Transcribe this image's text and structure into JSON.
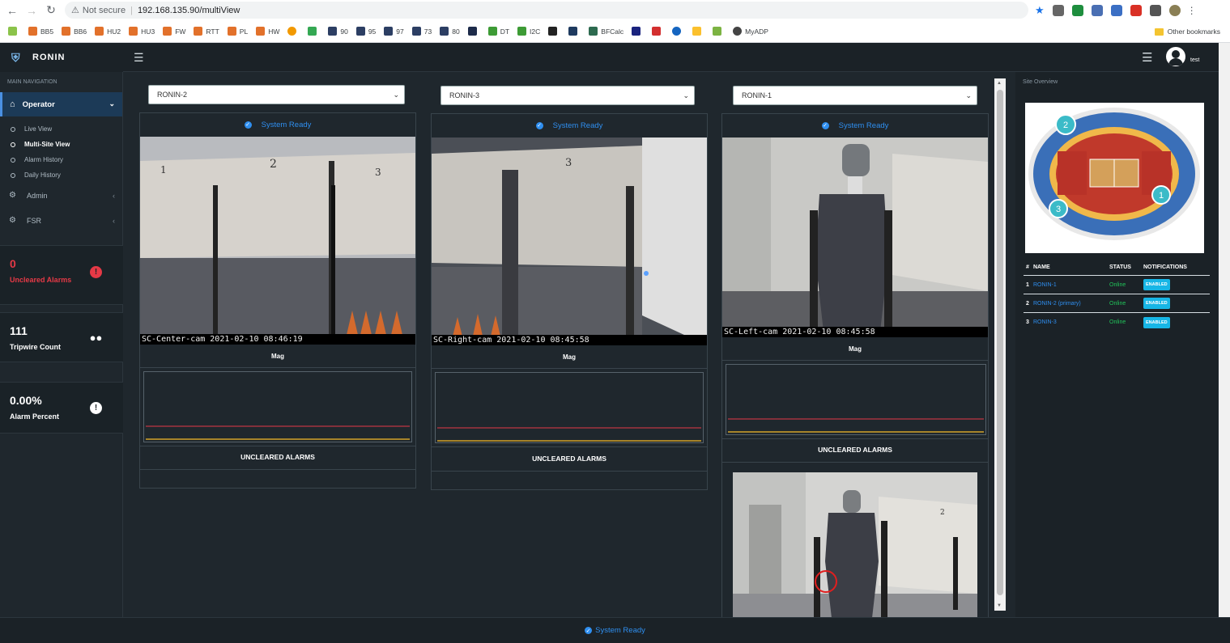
{
  "browser": {
    "security_label": "Not secure",
    "url": "192.168.135.90/multiView",
    "bookmarks": [
      "BB5",
      "BB6",
      "HU2",
      "HU3",
      "FW",
      "RTT",
      "PL",
      "HW",
      "",
      "",
      "90",
      "95",
      "97",
      "73",
      "80",
      "",
      "DT",
      "I2C",
      "",
      "",
      "BFCalc",
      "",
      "",
      "",
      "",
      "",
      "MyADP"
    ],
    "other_bookmarks": "Other bookmarks"
  },
  "app": {
    "brand": "RONIN",
    "user": "test"
  },
  "sidebar": {
    "heading": "MAIN NAVIGATION",
    "operator_label": "Operator",
    "sub_items": [
      "Live View",
      "Multi-Site View",
      "Alarm History",
      "Daily History"
    ],
    "admin_label": "Admin",
    "fsr_label": "FSR"
  },
  "stats": {
    "uncleared": {
      "value": "0",
      "label": "Uncleared Alarms"
    },
    "tripwire": {
      "value": "111",
      "label": "Tripwire Count"
    },
    "alarm_percent": {
      "value": "0.00%",
      "label": "Alarm Percent"
    }
  },
  "columns": [
    {
      "select": "RONIN-2",
      "status": "System Ready",
      "caption": "SC-Center-cam 2021-02-10 08:46:19",
      "mag_title": "Mag",
      "alarm_title": "UNCLEARED ALARMS"
    },
    {
      "select": "RONIN-3",
      "status": "System Ready",
      "caption": "SC-Right-cam 2021-02-10 08:45:58",
      "mag_title": "Mag",
      "alarm_title": "UNCLEARED ALARMS"
    },
    {
      "select": "RONIN-1",
      "status": "System Ready",
      "caption": "SC-Left-cam 2021-02-10 08:45:58",
      "mag_title": "Mag",
      "alarm_title": "UNCLEARED ALARMS"
    }
  ],
  "site_overview": {
    "title": "Site Overview",
    "markers": [
      "1",
      "2",
      "3"
    ],
    "columns": [
      "#",
      "NAME",
      "STATUS",
      "NOTIFICATIONS"
    ],
    "rows": [
      {
        "num": "1",
        "name": "RONIN-1",
        "status": "Online",
        "notif": "ENABLED"
      },
      {
        "num": "2",
        "name": "RONIN-2 (primary)",
        "status": "Online",
        "notif": "ENABLED"
      },
      {
        "num": "3",
        "name": "RONIN-3",
        "status": "Online",
        "notif": "ENABLED"
      }
    ]
  },
  "footer": {
    "status": "System Ready"
  },
  "colors": {
    "accent": "#2f8ff0",
    "online": "#21c45a",
    "badge": "#17b6e6",
    "alarm": "#e53946"
  }
}
